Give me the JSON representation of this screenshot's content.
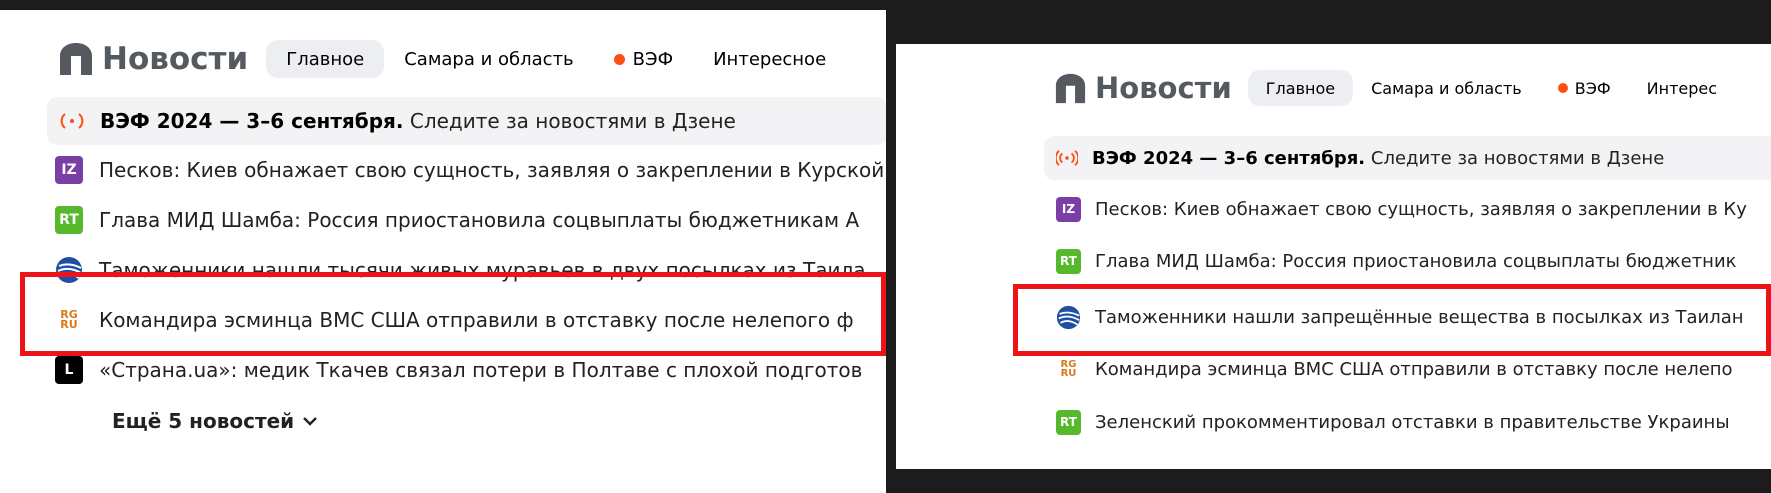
{
  "left": {
    "logo": "Новости",
    "tabs": [
      "Главное",
      "Самара и область",
      "ВЭФ",
      "Интересное"
    ],
    "featured": {
      "bold": "ВЭФ 2024 — 3–6 сентября.",
      "rest": " Следите за новостями в Дзене"
    },
    "items": [
      {
        "src": "IZ",
        "text": "Песков: Киев обнажает свою сущность, заявляя о закреплении в Курской"
      },
      {
        "src": "RT",
        "text": "Глава МИД Шамба: Россия приостановила соцвыплаты бюджетникам А"
      },
      {
        "src": "",
        "text": "Таможенники нашли тысячи живых муравьев в двух посылках из Таила"
      },
      {
        "src": "RG RU",
        "text": "Командира эсминца ВМС США отправили в отставку после нелепого ф"
      },
      {
        "src": "L",
        "text": "«Страна.ua»: медик Ткачев связал потери в Полтаве с плохой подготов"
      }
    ],
    "more": "Ещё 5 новостей"
  },
  "right": {
    "logo": "Новости",
    "tabs": [
      "Главное",
      "Самара и область",
      "ВЭФ",
      "Интерес"
    ],
    "featured": {
      "bold": "ВЭФ 2024 — 3–6 сентября.",
      "rest": " Следите за новостями в Дзене"
    },
    "items": [
      {
        "src": "IZ",
        "text": "Песков: Киев обнажает свою сущность, заявляя о закреплении в Ку"
      },
      {
        "src": "RT",
        "text": "Глава МИД Шамба: Россия приостановила соцвыплаты бюджетник"
      },
      {
        "src": "",
        "text": "Таможенники нашли запрещённые вещества в посылках из Таилан"
      },
      {
        "src": "RG RU",
        "text": "Командира эсминца ВМС США отправили в отставку после нелепо"
      },
      {
        "src": "RT",
        "text": "Зеленский прокомментировал отставки в правительстве Украины"
      }
    ]
  },
  "colors": {
    "accent": "#fc4f14",
    "highlight": "#ec1418",
    "logo": "#555a60",
    "active_tab": "#eceef2"
  }
}
